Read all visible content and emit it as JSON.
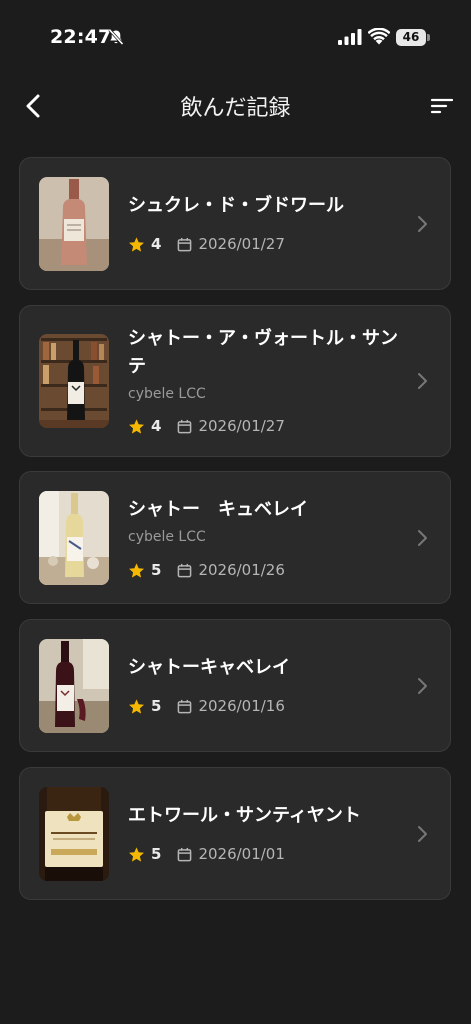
{
  "status_bar": {
    "time": "22:47",
    "battery": "46"
  },
  "header": {
    "title": "飲んだ記録"
  },
  "colors": {
    "background": "#1c1c1c",
    "card": "#2a2a2a",
    "star": "#f5b800",
    "muted": "#9a9a9a"
  },
  "records": [
    {
      "name": "シュクレ・ド・ブドワール",
      "producer": "",
      "rating": "4",
      "date": "2026/01/27"
    },
    {
      "name": "シャトー・ア・ヴォートル・サンテ",
      "producer": "cybele LCC",
      "rating": "4",
      "date": "2026/01/27"
    },
    {
      "name": "シャトー　キュベレイ",
      "producer": "cybele LCC",
      "rating": "5",
      "date": "2026/01/26"
    },
    {
      "name": "シャトーキャベレイ",
      "producer": "",
      "rating": "5",
      "date": "2026/01/16"
    },
    {
      "name": "エトワール・サンティヤント",
      "producer": "",
      "rating": "5",
      "date": "2026/01/01"
    }
  ]
}
